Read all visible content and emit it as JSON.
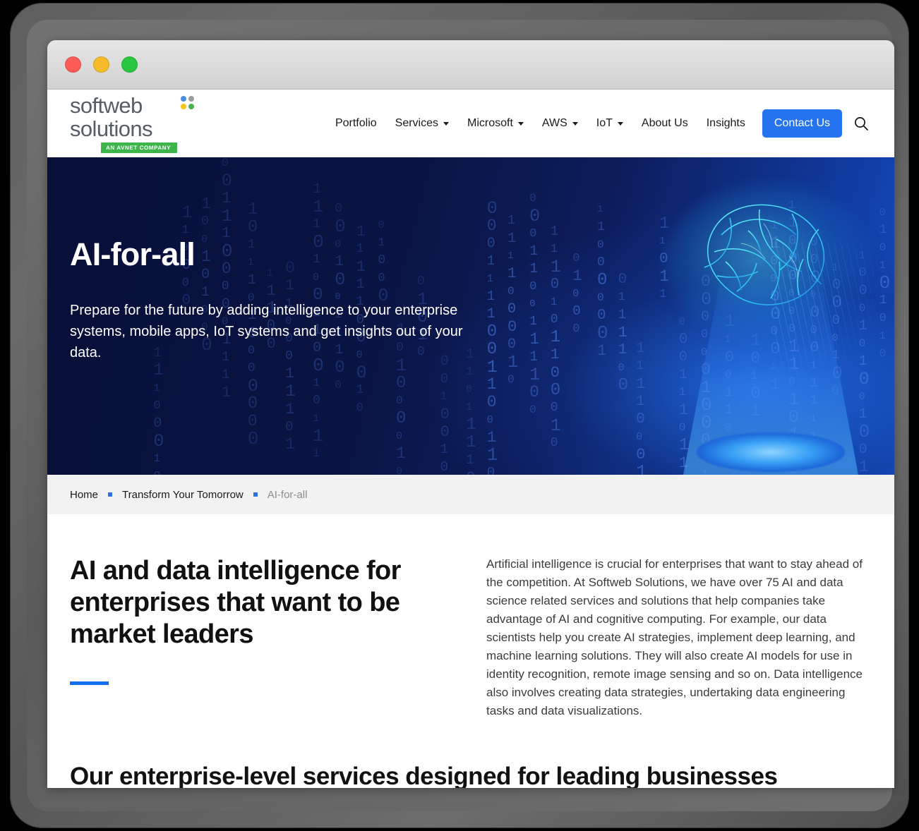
{
  "window": {
    "traffic_lights": [
      {
        "name": "close",
        "color": "#fc5b57"
      },
      {
        "name": "minimize",
        "color": "#f6bb28"
      },
      {
        "name": "maximize",
        "color": "#28c73f"
      }
    ]
  },
  "logo": {
    "line1": "softweb",
    "line2": "solutions",
    "badge": "AN AVNET COMPANY",
    "dot_colors": [
      "#4a90e2",
      "#9b9b9b",
      "#f5c518",
      "#4caf50"
    ],
    "badge_color": "#3cb54a",
    "word_color": "#565d66"
  },
  "nav": {
    "items": [
      {
        "label": "Portfolio",
        "has_dropdown": false
      },
      {
        "label": "Services",
        "has_dropdown": true
      },
      {
        "label": "Microsoft",
        "has_dropdown": true
      },
      {
        "label": "AWS",
        "has_dropdown": true
      },
      {
        "label": "IoT",
        "has_dropdown": true
      },
      {
        "label": "About Us",
        "has_dropdown": false
      },
      {
        "label": "Insights",
        "has_dropdown": false
      }
    ],
    "cta_label": "Contact Us",
    "cta_color": "#2673f0",
    "search_icon": "search-icon"
  },
  "hero": {
    "title": "AI-for-all",
    "subtitle": "Prepare for the future by adding intelligence to your enterprise systems, mobile apps, IoT systems and get insights out of your data.",
    "background_description": "binary-code-digits",
    "visual": "holographic-brain",
    "bg_color_dark": "#070f38",
    "bg_color_light": "#1552c8"
  },
  "breadcrumb": {
    "items": [
      {
        "label": "Home",
        "current": false
      },
      {
        "label": "Transform Your Tomorrow",
        "current": false
      },
      {
        "label": "AI-for-all",
        "current": true
      }
    ],
    "separator_color": "#2f6fe0"
  },
  "main": {
    "section_title": "AI and data intelligence for enterprises that want to be market leaders",
    "rule_color": "#1570ef",
    "body": "Artificial intelligence is crucial for enterprises that want to stay ahead of the competition. At Softweb Solutions, we have over 75 AI and data science related services and solutions that help companies take advantage of AI and cognitive computing. For example, our data scientists help you create AI strategies, implement deep learning, and machine learning solutions. They will also create AI models for use in identity recognition, remote image sensing and so on. Data intelligence also involves creating data strategies, undertaking data engineering tasks and data visualizations.",
    "bottom_title": "Our enterprise-level services designed for leading businesses"
  }
}
